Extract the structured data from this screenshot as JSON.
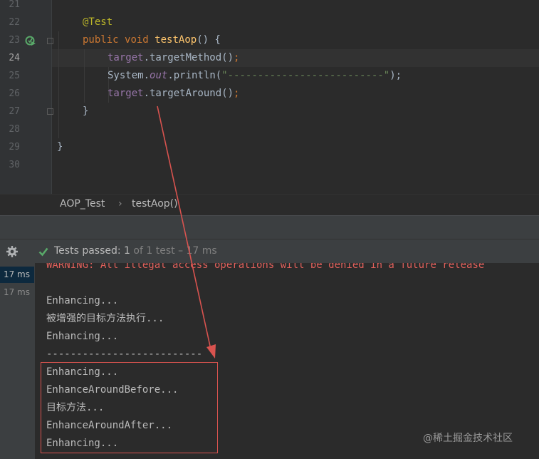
{
  "editor": {
    "line_numbers": [
      "21",
      "22",
      "23",
      "24",
      "25",
      "26",
      "27",
      "28",
      "29",
      "30"
    ],
    "lines": {
      "l22_annotation": "@Test",
      "l23_kw1": "public",
      "l23_kw2": "void",
      "l23_method": "testAop",
      "l23_rest": "() {",
      "l24_field": "target",
      "l24_rest": ".targetMethod()",
      "l24_semi": ";",
      "l25_a": "System.",
      "l25_out": "out",
      "l25_b": ".println(",
      "l25_str": "\"--------------------------\"",
      "l25_c": ");",
      "l26_field": "target",
      "l26_rest": ".targetAround()",
      "l26_semi": ";",
      "l27": "}",
      "l29": "}"
    }
  },
  "breadcrumb": {
    "class_name": "AOP_Test",
    "separator": "›",
    "method_name": "testAop()"
  },
  "run_panel": {
    "status_label": "Tests passed:",
    "passed_count": "1",
    "total_text": "of 1 test",
    "duration_text": "– 17 ms",
    "tree": [
      {
        "duration": "17 ms"
      },
      {
        "duration": "17 ms"
      }
    ]
  },
  "console": {
    "lines": [
      "WARNING: All illegal access operations will be denied in a future release",
      "",
      "Enhancing...",
      "被增强的目标方法执行...",
      "Enhancing...",
      "--------------------------",
      "Enhancing...",
      "EnhanceAroundBefore...",
      "目标方法...",
      "EnhanceAroundAfter...",
      "Enhancing..."
    ]
  },
  "watermark": "@稀土掘金技术社区",
  "colors": {
    "editor_bg": "#2b2b2b",
    "keyword": "#cc7832",
    "method": "#ffc66d",
    "field": "#9876aa",
    "string": "#6a8759",
    "annotation": "#bbb529",
    "highlight_red": "#d9534f",
    "pass_green": "#59a869"
  },
  "icons": [
    "run-test-icon",
    "gear-icon",
    "check-icon",
    "fold-icon"
  ]
}
